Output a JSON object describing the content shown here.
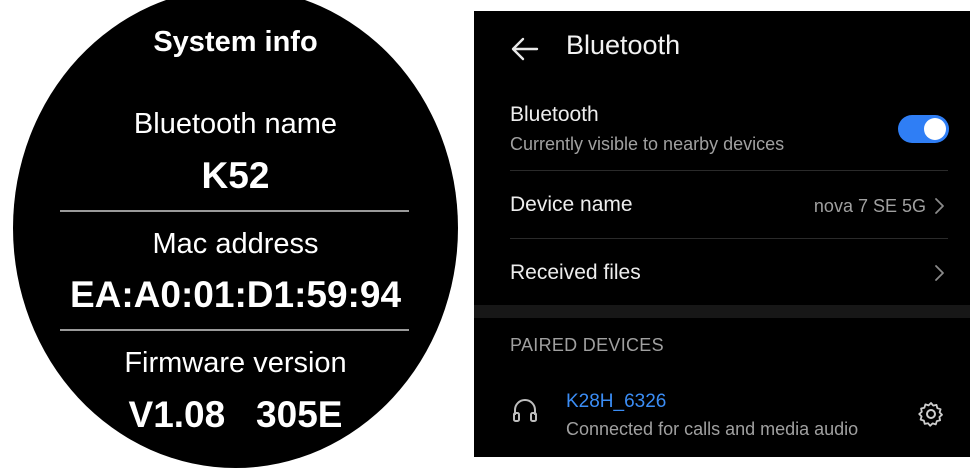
{
  "watch": {
    "title": "System info",
    "bluetooth_name_label": "Bluetooth name",
    "bluetooth_name_value": "K52",
    "mac_label": "Mac address",
    "mac_value": "EA:A0:01:D1:59:94",
    "firmware_label": "Firmware version",
    "firmware_value": "V1.08   305E"
  },
  "settings": {
    "title": "Bluetooth",
    "bluetooth_row": {
      "title": "Bluetooth",
      "subtitle": "Currently visible to nearby devices",
      "enabled": true
    },
    "device_name_row": {
      "title": "Device name",
      "value": "nova 7 SE 5G"
    },
    "received_files_row": {
      "title": "Received files"
    },
    "paired_section_label": "PAIRED DEVICES",
    "paired_devices": [
      {
        "name": "K28H_6326",
        "status": "Connected for calls and media audio",
        "icon": "headset-icon"
      }
    ],
    "colors": {
      "accent": "#2f7ef5",
      "link": "#3b8df5",
      "background": "#000000"
    }
  }
}
